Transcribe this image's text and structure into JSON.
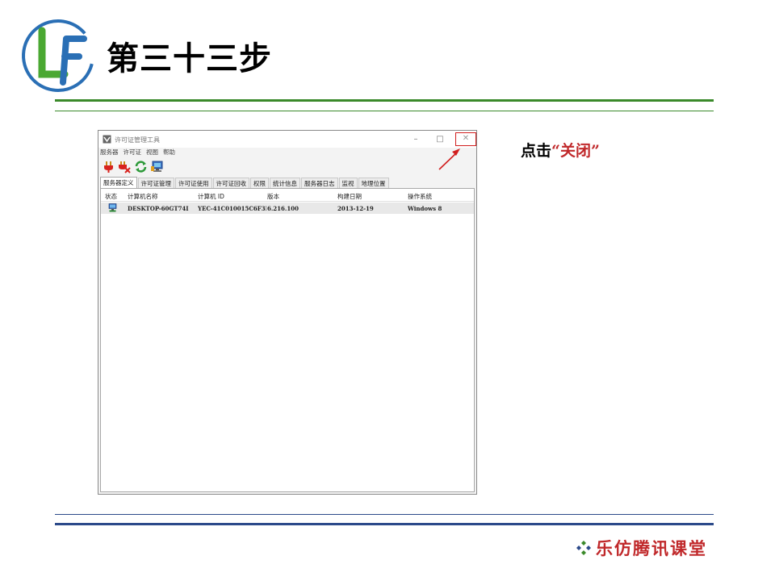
{
  "slide": {
    "title": "第三十三步",
    "instruction_prefix": "点击",
    "instruction_highlight": "“关闭”",
    "brand": "乐仿腾讯课堂",
    "logo_icon": "lf-logo-icon",
    "colors": {
      "green_rule": "#3a8a2a",
      "blue_rule": "#2c4a8a",
      "accent_red": "#c0282a"
    }
  },
  "window": {
    "title": "许可证管理工具",
    "controls": {
      "minimize": "–",
      "maximize": "□",
      "close": "✕"
    },
    "menu": [
      "服务器",
      "许可证",
      "视图",
      "帮助"
    ],
    "toolbar_icons": [
      "plug-connect-icon",
      "plug-disconnect-icon",
      "refresh-icon",
      "monitor-icon"
    ],
    "tabs": [
      "服务器定义",
      "许可证管理",
      "许可证使用",
      "许可证回收",
      "权限",
      "统计信息",
      "服务器日志",
      "监视",
      "地理位置"
    ],
    "active_tab": 0,
    "columns": [
      "状态",
      "计算机名称",
      "计算机 ID",
      "版本",
      "构建日期",
      "操作系统"
    ],
    "rows": [
      {
        "status_icon": "computer-icon",
        "name": "DESKTOP-60GT74I",
        "id": "YEC-41C010015C6F3F",
        "version": "6.216.100",
        "build_date": "2013-12-19",
        "os": "Windows 8"
      }
    ]
  }
}
